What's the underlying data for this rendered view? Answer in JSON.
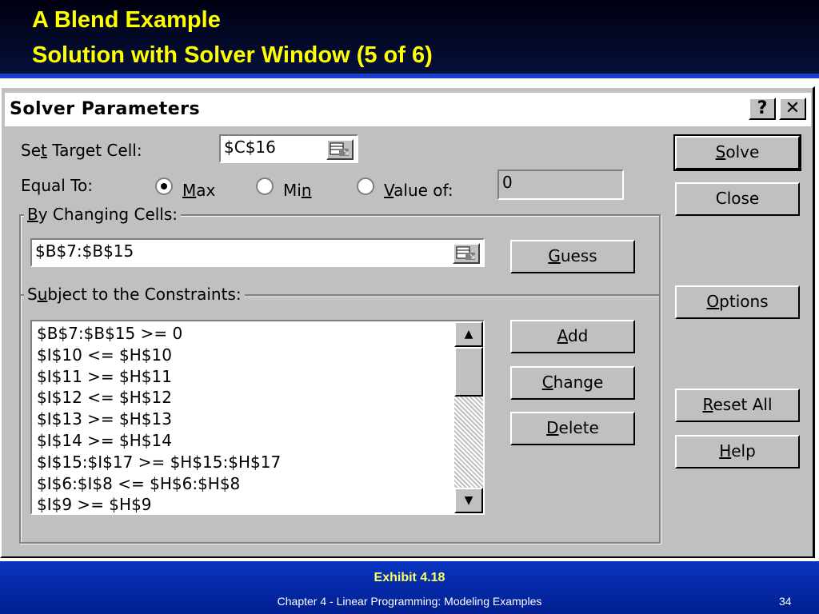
{
  "slide": {
    "title_line1": "A Blend Example",
    "title_line2": "Solution with Solver Window (5 of 6)",
    "exhibit": "Exhibit 4.18",
    "footer": "Chapter 4 - Linear Programming:  Modeling Examples",
    "page_number": "34"
  },
  "dialog": {
    "title": "Solver Parameters",
    "help_glyph": "?",
    "close_glyph": "✕",
    "set_target": {
      "pre": "Se",
      "key": "t",
      "post": " Target Cell:",
      "value": "$C$16"
    },
    "equal_to": {
      "label": "Equal To:",
      "max": {
        "key": "M",
        "post": "ax",
        "selected": true
      },
      "min": {
        "pre": "Mi",
        "key": "n",
        "selected": false
      },
      "value_of": {
        "key": "V",
        "post": "alue of:",
        "value": "0",
        "selected": false
      }
    },
    "changing_cells": {
      "key": "B",
      "post": "y Changing Cells:",
      "value": "$B$7:$B$15"
    },
    "constraints": {
      "pre": "S",
      "key": "u",
      "post": "bject to the Constraints:",
      "items": [
        "$B$7:$B$15 >= 0",
        "$I$10 <= $H$10",
        "$I$11 >= $H$11",
        "$I$12 <= $H$12",
        "$I$13 >= $H$13",
        "$I$14 >= $H$14",
        "$I$15:$I$17 >= $H$15:$H$17",
        "$I$6:$I$8 <= $H$6:$H$8",
        "$I$9 >= $H$9"
      ]
    },
    "buttons": {
      "solve": {
        "key": "S",
        "post": "olve"
      },
      "close": {
        "text": "Close"
      },
      "guess": {
        "key": "G",
        "post": "uess"
      },
      "options": {
        "key": "O",
        "post": "ptions"
      },
      "add": {
        "key": "A",
        "post": "dd"
      },
      "change": {
        "key": "C",
        "post": "hange"
      },
      "delete": {
        "key": "D",
        "post": "elete"
      },
      "reset_all": {
        "key": "R",
        "post": "eset All"
      },
      "help": {
        "key": "H",
        "post": "elp"
      }
    },
    "scroll": {
      "up": "▲",
      "down": "▼"
    }
  }
}
